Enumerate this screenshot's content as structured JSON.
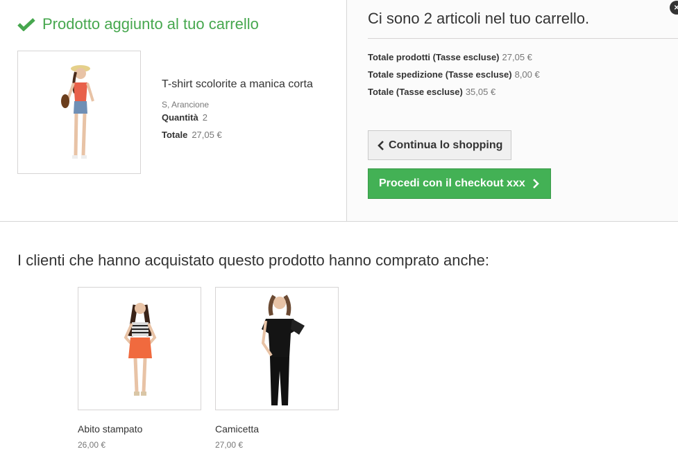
{
  "layer": {
    "success_title": "Prodotto aggiunto al tuo carrello",
    "product": {
      "name": "T-shirt scolorite a manica corta",
      "attributes": "S, Arancione",
      "quantity_label": "Quantità",
      "quantity_value": "2",
      "total_label": "Totale",
      "total_value": "27,05 €"
    }
  },
  "cart": {
    "count_text": "Ci sono 2 articoli nel tuo carrello.",
    "totals": [
      {
        "label": "Totale prodotti (Tasse escluse)",
        "value": "27,05 €"
      },
      {
        "label": "Totale spedizione (Tasse escluse)",
        "value": "8,00 €"
      },
      {
        "label": "Totale (Tasse escluse)",
        "value": "35,05 €"
      }
    ],
    "continue_label": "Continua lo shopping",
    "checkout_label": "Procedi con il checkout xxx",
    "close_icon": "close-icon"
  },
  "crossselling": {
    "title": "I clienti che hanno acquistato questo prodotto hanno comprato anche:",
    "items": [
      {
        "name": "Abito stampato",
        "price": "26,00 €"
      },
      {
        "name": "Camicetta",
        "price": "27,00 €"
      }
    ]
  },
  "colors": {
    "success_green": "#46a74e",
    "checkout_green": "#43b155"
  }
}
